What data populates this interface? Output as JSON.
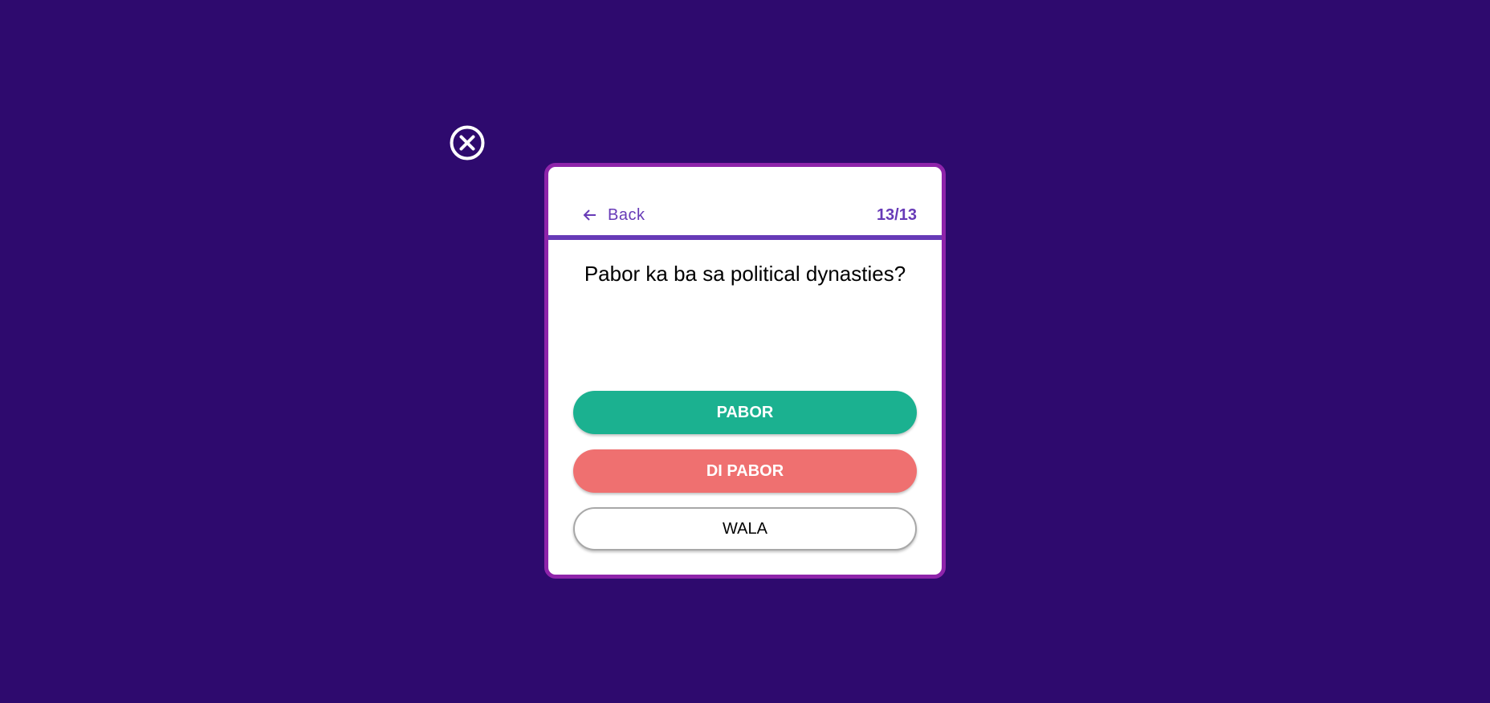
{
  "close": {
    "icon": "close-circle-icon"
  },
  "header": {
    "back_label": "Back",
    "back_icon": "arrow-left-icon",
    "counter": "13/13"
  },
  "progress": {
    "current": 13,
    "total": 13,
    "fraction": 1.0
  },
  "question": "Pabor ka ba sa political dynasties?",
  "answers": [
    {
      "label": "PABOR",
      "color": "#1bb190"
    },
    {
      "label": "DI PABOR",
      "color": "#ef7070"
    },
    {
      "label": "WALA",
      "color": "#ffffff"
    }
  ],
  "colors": {
    "background": "#2e0a6e",
    "card_border": "#8e24aa",
    "accent": "#673ab7"
  }
}
